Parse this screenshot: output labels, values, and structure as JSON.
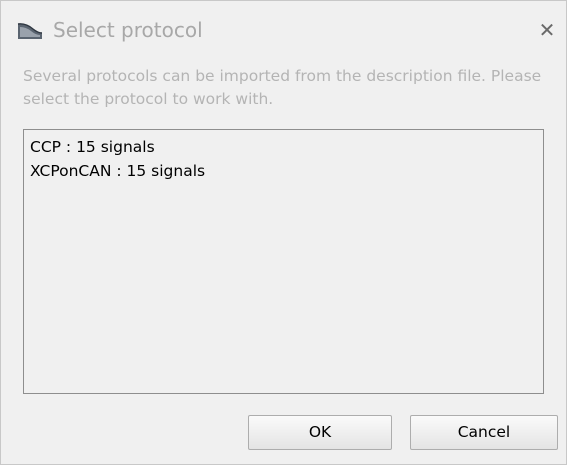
{
  "dialog": {
    "title": "Select protocol",
    "title_icon": "app-logo-icon",
    "close_glyph": "✕",
    "description": "Several protocols can be imported from the description file. Please select the protocol to work with.",
    "protocols": [
      "CCP : 15 signals",
      "XCPonCAN : 15 signals"
    ],
    "buttons": {
      "ok_label": "OK",
      "cancel_label": "Cancel"
    }
  },
  "colors": {
    "window_bg": "#f0f0f0",
    "title_text": "#a8a8a8",
    "description_text": "#b4b4b4",
    "list_border": "#8e8e8e"
  }
}
